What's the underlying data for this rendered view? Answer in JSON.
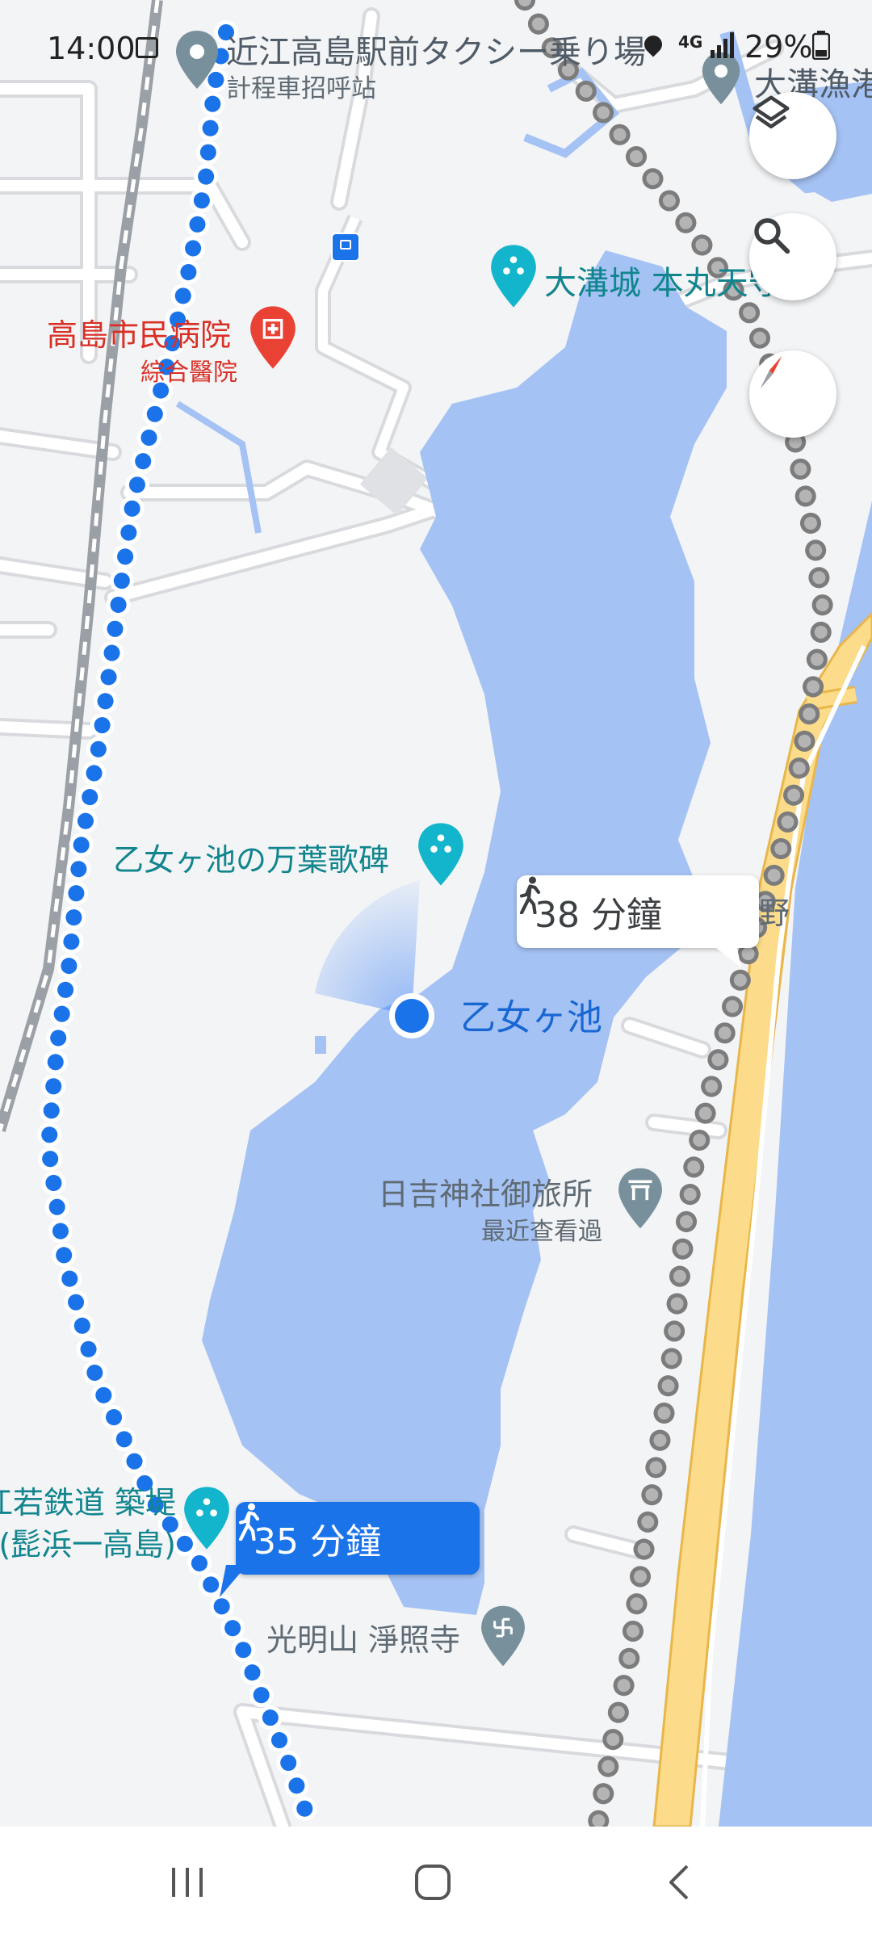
{
  "status_bar": {
    "time": "14:00",
    "network": "4G",
    "battery": "29%"
  },
  "places": {
    "taxi_stand": {
      "name": "近江高島駅前タクシー乗り場",
      "subtitle": "計程車招呼站"
    },
    "hospital": {
      "name": "高島市民病院",
      "subtitle": "綜合醫院"
    },
    "castle": {
      "name": "大溝城 本丸天守跡"
    },
    "fishing_port": {
      "name": "大溝漁港"
    },
    "monument": {
      "name": "乙女ヶ池の万葉歌碑"
    },
    "pond": {
      "name": "乙女ヶ池"
    },
    "shrine": {
      "name": "日吉神社御旅所",
      "subtitle": "最近查看過"
    },
    "railway_site": {
      "line1": "江若鉄道 築堤",
      "line2": "(髭浜一高島)"
    },
    "temple": {
      "name": "光明山 淨照寺"
    },
    "katsuno": {
      "name": "勝野"
    }
  },
  "routes": {
    "primary": {
      "duration": "35 分鐘",
      "mode_icon": "walk-icon",
      "color": "#1a73e8"
    },
    "alternative": {
      "duration": "38 分鐘",
      "mode_icon": "walk-icon",
      "color": "#9e9e9e"
    }
  },
  "controls": {
    "layers_icon": "layers-icon",
    "search_icon": "search-icon",
    "compass_icon": "compass-icon"
  },
  "nav_bar": {
    "recents_icon": "recents-icon",
    "home_icon": "home-icon",
    "back_icon": "back-icon"
  },
  "colors": {
    "water": "#a5c2f4",
    "land": "#f3f4f6",
    "highway": "#fcdc8a",
    "teal_poi": "#12b5cb",
    "hospital_red": "#e94235"
  }
}
